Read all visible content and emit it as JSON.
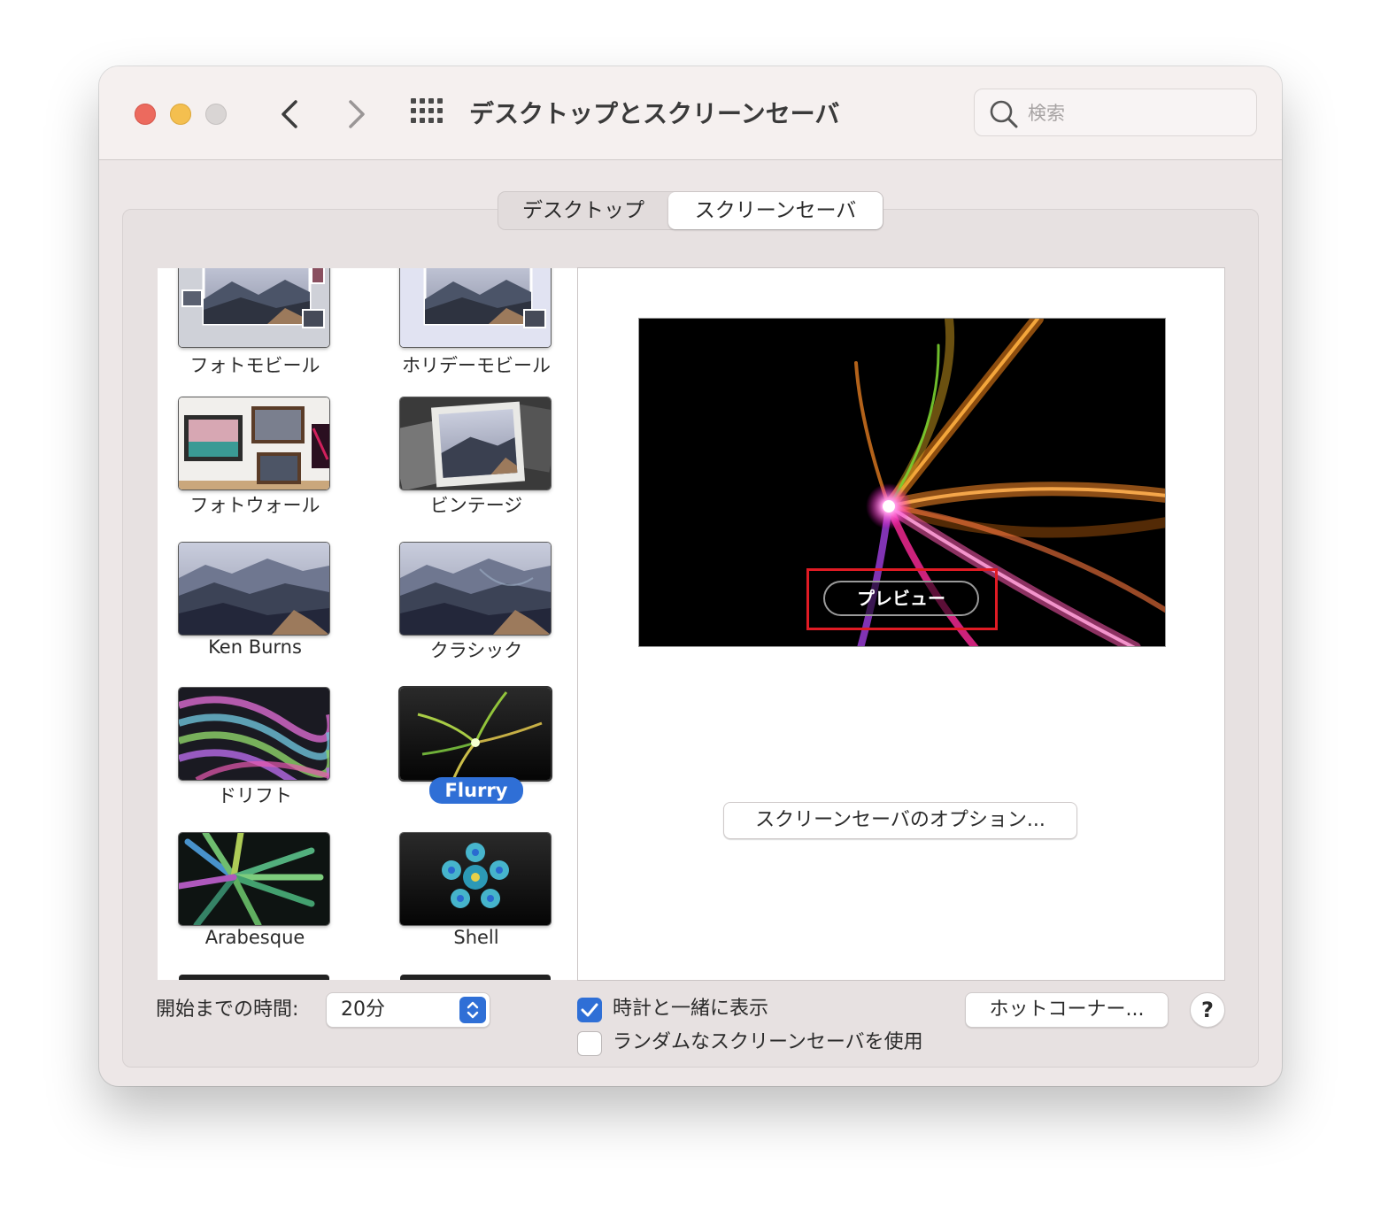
{
  "window": {
    "title": "デスクトップとスクリーンセーバ",
    "search_placeholder": "検索"
  },
  "tabs": [
    {
      "label": "デスクトップ",
      "selected": false
    },
    {
      "label": "スクリーンセーバ",
      "selected": true
    }
  ],
  "screensavers": [
    {
      "label": "フォトモビール",
      "icon": "mountain-collage-thumbnail"
    },
    {
      "label": "ホリデーモビール",
      "icon": "mountain-collage-thumbnail"
    },
    {
      "label": "フォトウォール",
      "icon": "framed-photos-thumbnail"
    },
    {
      "label": "ビンテージ",
      "icon": "stacked-prints-thumbnail"
    },
    {
      "label": "Ken Burns",
      "icon": "mountain-thumbnail"
    },
    {
      "label": "クラシック",
      "icon": "mountain-thumbnail"
    },
    {
      "label": "ドリフト",
      "icon": "drift-waves-thumbnail"
    },
    {
      "label": "Flurry",
      "icon": "flurry-thumbnail",
      "selected": true
    },
    {
      "label": "Arabesque",
      "icon": "arabesque-thumbnail"
    },
    {
      "label": "Shell",
      "icon": "shell-thumbnail"
    }
  ],
  "preview": {
    "button_label": "プレビュー",
    "options_button": "スクリーンセーバのオプション..."
  },
  "footer": {
    "start_label": "開始までの時間:",
    "start_value": "20分",
    "show_clock_label": "時計と一緒に表示",
    "show_clock_checked": true,
    "random_label": "ランダムなスクリーンセーバを使用",
    "random_checked": false,
    "hot_corners_button": "ホットコーナー...",
    "help_button": "?"
  },
  "colors": {
    "accent": "#2f6fd6",
    "highlight": "#e01b24",
    "close": "#ec6a5e",
    "minimize": "#f4bf4f",
    "zoom_disabled": "#d9d5d4"
  }
}
